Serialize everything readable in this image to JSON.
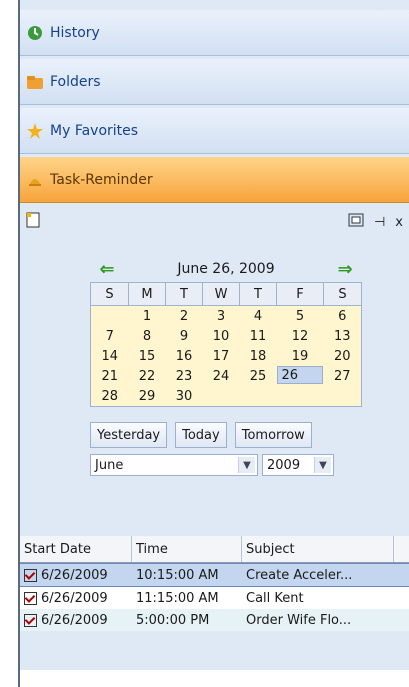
{
  "nav": {
    "items": [
      {
        "label": "History",
        "icon": "history-icon"
      },
      {
        "label": "Folders",
        "icon": "folder-icon"
      },
      {
        "label": "My Favorites",
        "icon": "star-icon"
      },
      {
        "label": "Task-Reminder",
        "icon": "bell-icon",
        "active": true
      }
    ]
  },
  "toolbar": {
    "close": "x"
  },
  "calendar": {
    "title": "June 26, 2009",
    "days": [
      "S",
      "M",
      "T",
      "W",
      "T",
      "F",
      "S"
    ],
    "weeks": [
      [
        "",
        "1",
        "2",
        "3",
        "4",
        "5",
        "6"
      ],
      [
        "7",
        "8",
        "9",
        "10",
        "11",
        "12",
        "13"
      ],
      [
        "14",
        "15",
        "16",
        "17",
        "18",
        "19",
        "20"
      ],
      [
        "21",
        "22",
        "23",
        "24",
        "25",
        "26",
        "27"
      ],
      [
        "28",
        "29",
        "30",
        "",
        "",
        "",
        ""
      ]
    ],
    "selected_day": "26"
  },
  "buttons": {
    "yesterday": "Yesterday",
    "today": "Today",
    "tomorrow": "Tomorrow"
  },
  "selects": {
    "month": "June",
    "year": "2009"
  },
  "table": {
    "headers": [
      "Start Date",
      "Time",
      "Subject"
    ],
    "rows": [
      {
        "date": "6/26/2009",
        "time": "10:15:00 AM",
        "subject": "Create Acceler...",
        "selected": true
      },
      {
        "date": "6/26/2009",
        "time": "11:15:00 AM",
        "subject": "Call Kent"
      },
      {
        "date": "6/26/2009",
        "time": "5:00:00 PM",
        "subject": "Order Wife Flo..."
      }
    ]
  }
}
